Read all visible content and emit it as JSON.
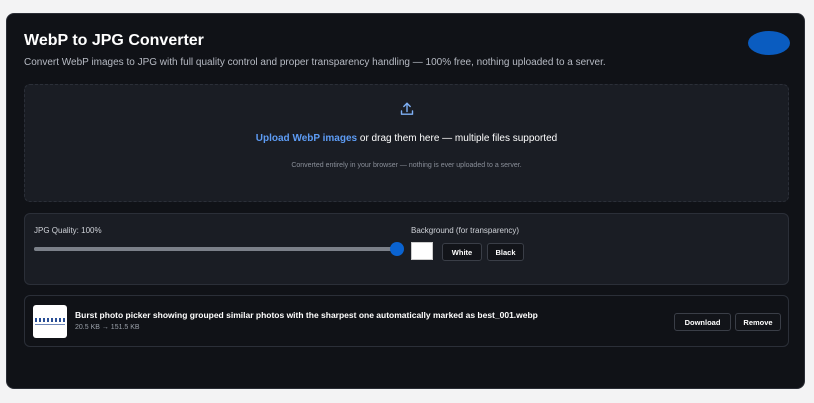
{
  "app": {
    "title": "WebP to JPG Converter",
    "subtitle": "Convert WebP images to JPG with full quality control and proper transparency handling — 100% free, nothing uploaded to a server."
  },
  "dropzone": {
    "link_text": "Upload WebP images",
    "rest_text": " or drag them here — multiple files supported",
    "note": "Converted entirely in your browser — nothing is ever uploaded to a server.",
    "icon": "upload-icon"
  },
  "settings": {
    "quality_label": "JPG Quality: 100%",
    "quality_value": 100,
    "background_label": "Background (for transparency)",
    "background_color": "#ffffff",
    "white_label": "White",
    "black_label": "Black"
  },
  "files": [
    {
      "name": "Burst photo picker showing grouped similar photos with the sharpest one automatically marked as best_001.webp",
      "size_text": "20.5 KB → 151.5 KB",
      "download_label": "Download",
      "remove_label": "Remove"
    }
  ],
  "colors": {
    "accent": "#0a63d1",
    "link": "#5d9cf5",
    "card_bg": "#101217"
  }
}
